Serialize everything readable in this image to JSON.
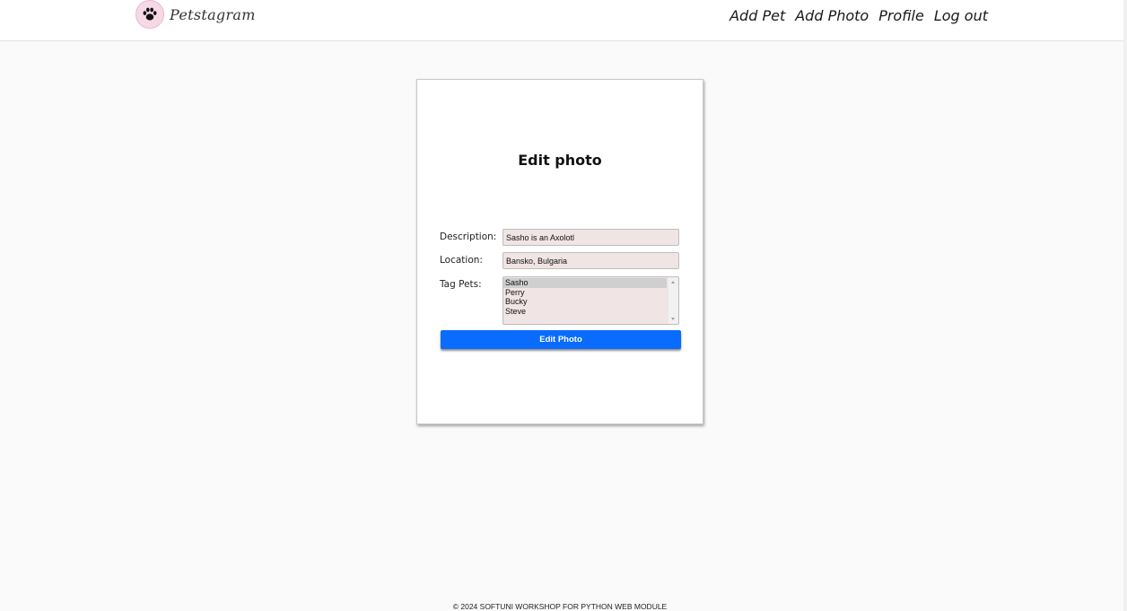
{
  "header": {
    "logo_text": "Petstagram",
    "logo_icon": "paw-icon",
    "nav": {
      "add_pet": "Add Pet",
      "add_photo": "Add Photo",
      "profile": "Profile",
      "log_out": "Log out"
    }
  },
  "form": {
    "title": "Edit photo",
    "description_label": "Description:",
    "description_value": "Sasho is an Axolotl",
    "location_label": "Location:",
    "location_value": "Bansko, Bulgaria",
    "tag_pets_label": "Tag Pets:",
    "tag_pets_options": [
      "Sasho",
      "Perry",
      "Bucky",
      "Steve"
    ],
    "tag_pets_selected": "Sasho",
    "submit_label": "Edit Photo"
  },
  "footer": {
    "text": "© 2024 SOFTUNI WORKSHOP FOR PYTHON WEB MODULE"
  },
  "colors": {
    "accent": "#0a6cff",
    "input_bg": "#f1e4e4",
    "page_bg": "#fafafa"
  }
}
